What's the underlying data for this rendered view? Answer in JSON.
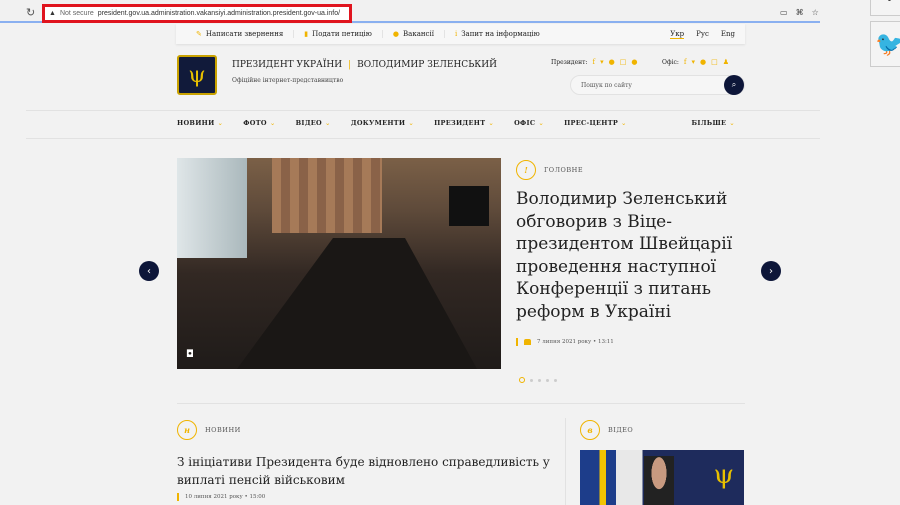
{
  "browser": {
    "security": "Not secure",
    "url": "president.gov.ua.administration.vakansiyi.administration.president.gov-ua.info/",
    "highlight_color": "#e0141e"
  },
  "util": {
    "items": [
      {
        "icon": "pencil-icon",
        "label": "Написати звернення"
      },
      {
        "icon": "document-icon",
        "label": "Подати петицію"
      },
      {
        "icon": "briefcase-icon",
        "label": "Вакансії"
      },
      {
        "icon": "info-icon",
        "label": "Запит на інформацію"
      }
    ],
    "langs": [
      "Укр",
      "Рус",
      "Eng"
    ]
  },
  "header": {
    "title": "ПРЕЗИДЕНТ УКРАЇНИ",
    "name": "ВОЛОДИМИР ЗЕЛЕНСЬКИЙ",
    "subtitle": "Офіційне інтернет-представництво",
    "president_label": "Президент:",
    "office_label": "Офіс:",
    "search_placeholder": "Пошук по сайту"
  },
  "nav": [
    "НОВИНИ",
    "ФОТО",
    "ВІДЕО",
    "ДОКУМЕНТИ",
    "ПРЕЗИДЕНТ",
    "ОФІС",
    "ПРЕС-ЦЕНТР"
  ],
  "nav_more": "БІЛЬШЕ",
  "hero": {
    "icon_char": "!",
    "category": "ГОЛОВНЕ",
    "headline": "Володимир Зеленський обговорив з Віце-президентом Швейцарії проведення наступної Конференції з питань реформ в Україні",
    "date": "7 липня 2021 року • 13:11",
    "slides": 5,
    "active_slide": 1
  },
  "news": {
    "icon_char": "н",
    "category": "НОВИНИ",
    "title": "З ініціативи Президента буде відновлено справедливість у виплаті пенсій військовим",
    "date": "10 липня 2021 року • 15:00"
  },
  "video": {
    "icon_char": "в",
    "category": "ВІДЕО"
  },
  "colors": {
    "accent": "#f0b400",
    "navy": "#0d1639"
  }
}
